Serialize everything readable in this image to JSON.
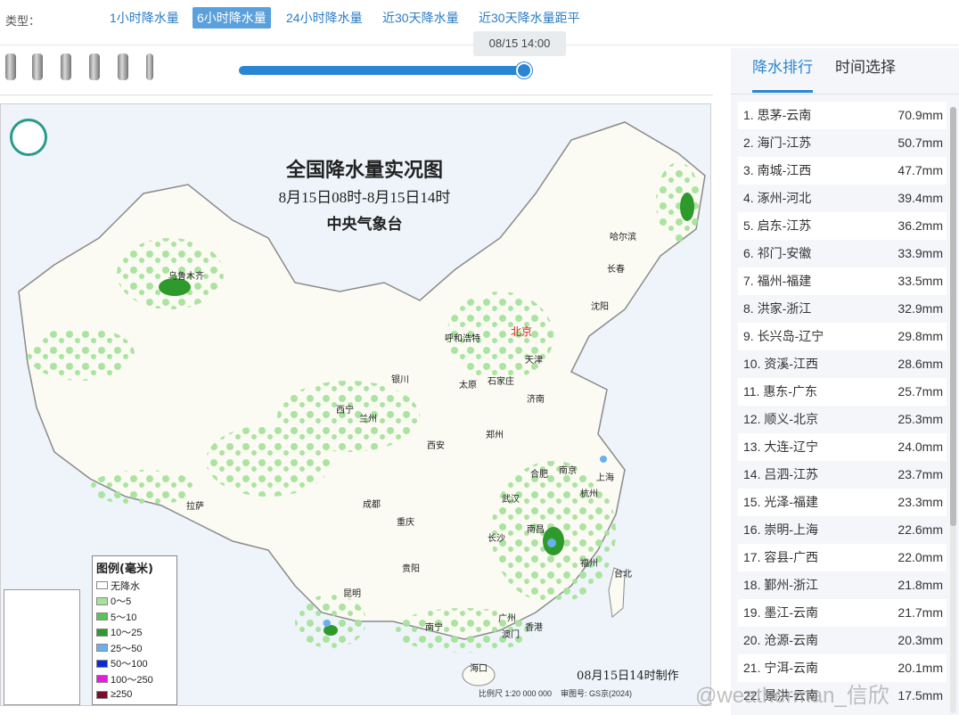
{
  "type_bar": {
    "label": "类型：",
    "tabs": [
      {
        "label": "1小时降水量",
        "active": false
      },
      {
        "label": "6小时降水量",
        "active": true
      },
      {
        "label": "24小时降水量",
        "active": false
      },
      {
        "label": "近30天降水量",
        "active": false
      },
      {
        "label": "近30天降水量距平",
        "active": false
      }
    ]
  },
  "timeline": {
    "current_time": "08/15 14:00",
    "progress": 1.0
  },
  "map": {
    "title": "全国降水量实况图",
    "subtitle": "8月15日08时-8月15日14时",
    "issuer": "中央气象台",
    "made_time": "08月15日14时制作",
    "scale": "比例尺 1:20 000 000",
    "review_number": "审图号: GS京(2024)",
    "legend": {
      "title": "图例(毫米)",
      "items": [
        {
          "label": "无降水",
          "color": "#ffffff"
        },
        {
          "label": "0～5",
          "color": "#a6e39a"
        },
        {
          "label": "5～10",
          "color": "#5cc25a"
        },
        {
          "label": "10～25",
          "color": "#2e9a2c"
        },
        {
          "label": "25～50",
          "color": "#6ab0f0"
        },
        {
          "label": "50～100",
          "color": "#0a2ad8"
        },
        {
          "label": "100～250",
          "color": "#e41adc"
        },
        {
          "label": "≥250",
          "color": "#7a0f2c"
        }
      ]
    },
    "cities": [
      {
        "name": "北京",
        "capital": true
      },
      {
        "name": "乌鲁木齐"
      },
      {
        "name": "哈尔滨"
      },
      {
        "name": "长春"
      },
      {
        "name": "沈阳"
      },
      {
        "name": "呼和浩特"
      },
      {
        "name": "天津"
      },
      {
        "name": "石家庄"
      },
      {
        "name": "太原"
      },
      {
        "name": "济南"
      },
      {
        "name": "银川"
      },
      {
        "name": "西宁"
      },
      {
        "name": "兰州"
      },
      {
        "name": "郑州"
      },
      {
        "name": "西安"
      },
      {
        "name": "合肥"
      },
      {
        "name": "南京"
      },
      {
        "name": "上海"
      },
      {
        "name": "杭州"
      },
      {
        "name": "武汉"
      },
      {
        "name": "拉萨"
      },
      {
        "name": "成都"
      },
      {
        "name": "重庆"
      },
      {
        "name": "长沙"
      },
      {
        "name": "南昌"
      },
      {
        "name": "福州"
      },
      {
        "name": "台北"
      },
      {
        "name": "贵阳"
      },
      {
        "name": "昆明"
      },
      {
        "name": "南宁"
      },
      {
        "name": "广州"
      },
      {
        "name": "香港"
      },
      {
        "name": "澳门"
      },
      {
        "name": "海口"
      }
    ]
  },
  "ranking": {
    "tabs": [
      "降水排行",
      "时间选择"
    ],
    "active_tab": "降水排行",
    "rows": [
      {
        "name": "1. 思茅-云南",
        "value": "70.9mm"
      },
      {
        "name": "2. 海门-江苏",
        "value": "50.7mm"
      },
      {
        "name": "3. 南城-江西",
        "value": "47.7mm"
      },
      {
        "name": "4. 涿州-河北",
        "value": "39.4mm"
      },
      {
        "name": "5. 启东-江苏",
        "value": "36.2mm"
      },
      {
        "name": "6. 祁门-安徽",
        "value": "33.9mm"
      },
      {
        "name": "7. 福州-福建",
        "value": "33.5mm"
      },
      {
        "name": "8. 洪家-浙江",
        "value": "32.9mm"
      },
      {
        "name": "9. 长兴岛-辽宁",
        "value": "29.8mm"
      },
      {
        "name": "10. 资溪-江西",
        "value": "28.6mm"
      },
      {
        "name": "11. 惠东-广东",
        "value": "25.7mm"
      },
      {
        "name": "12. 顺义-北京",
        "value": "25.3mm"
      },
      {
        "name": "13. 大连-辽宁",
        "value": "24.0mm"
      },
      {
        "name": "14. 吕泗-江苏",
        "value": "23.7mm"
      },
      {
        "name": "15. 光泽-福建",
        "value": "23.3mm"
      },
      {
        "name": "16. 崇明-上海",
        "value": "22.6mm"
      },
      {
        "name": "17. 容县-广西",
        "value": "22.0mm"
      },
      {
        "name": "18. 鄞州-浙江",
        "value": "21.8mm"
      },
      {
        "name": "19. 墨江-云南",
        "value": "21.7mm"
      },
      {
        "name": "20. 沧源-云南",
        "value": "20.3mm"
      },
      {
        "name": "21. 宁洱-云南",
        "value": "20.1mm"
      },
      {
        "name": "22. 景洪-云南",
        "value": "17.5mm"
      }
    ]
  },
  "watermark": "@weatherman_信欣"
}
